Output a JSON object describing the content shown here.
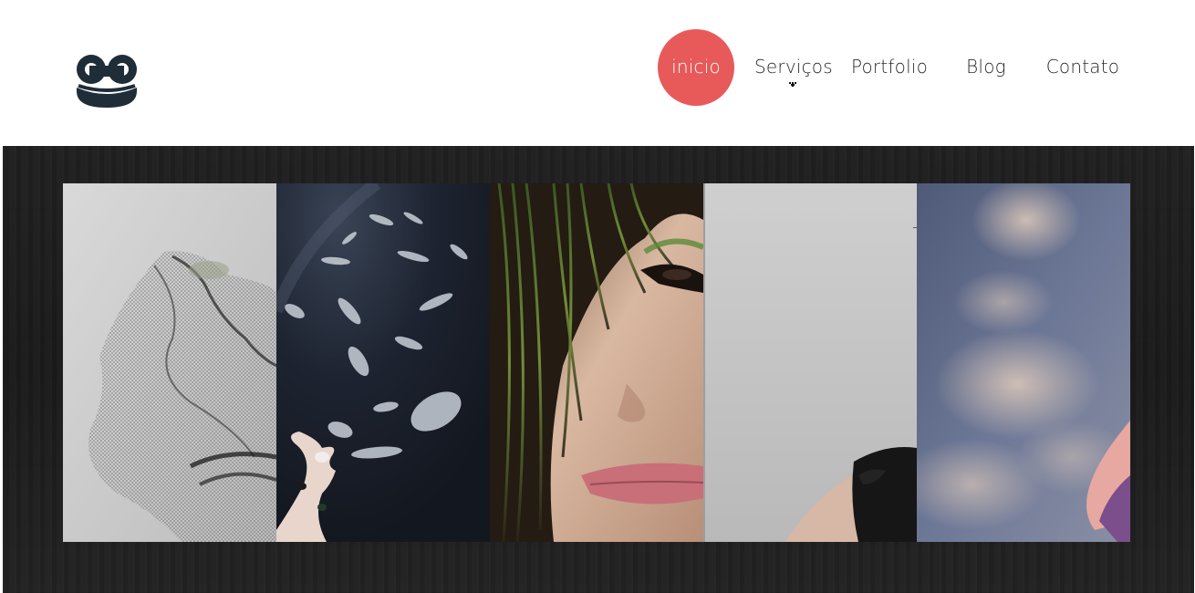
{
  "header": {
    "logo_icon": "smiley-face-logo-icon",
    "logo_color": "#1f2d38"
  },
  "nav": {
    "accent_color": "#e85a5a",
    "items": [
      {
        "label": "inicio",
        "active": true
      },
      {
        "label": "Serviços",
        "active": false
      },
      {
        "label": "Portfolio",
        "active": false
      },
      {
        "label": "Blog",
        "active": false
      },
      {
        "label": "Contato",
        "active": false
      }
    ]
  },
  "slider": {
    "background_color": "#1c1c1c",
    "slides": [
      {
        "name": "abstract-mesh-image"
      },
      {
        "name": "feathers-hand-image"
      },
      {
        "name": "face-closeup-image"
      },
      {
        "name": "woman-shoulder-image"
      },
      {
        "name": "sky-clouds-image"
      }
    ]
  }
}
